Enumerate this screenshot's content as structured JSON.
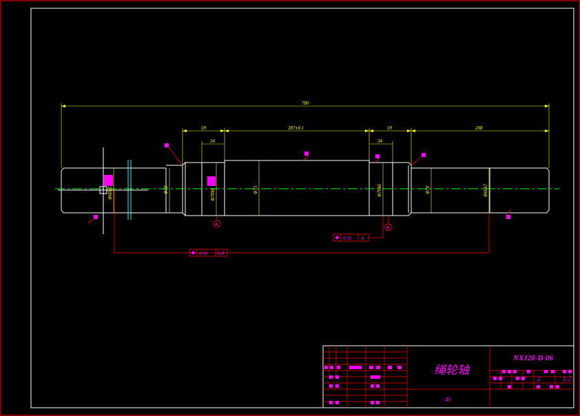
{
  "drawing": {
    "part_name": "绳轮轴",
    "drawing_number": "NXJ20-D-06",
    "material": "45",
    "sheet_count": "2",
    "scale": "1:2"
  },
  "dimensions": {
    "overall_length": "780",
    "seg_left": "59",
    "seg_center": "287±0.1",
    "seg_right": "59",
    "seg_end": "208",
    "key_left": "34",
    "key_right": "34",
    "dia_left": "Φ70",
    "dia_center": "Φ75",
    "dia_right": "Φ70k6",
    "dia_right2": "Φ70",
    "dia_end": "Φ60k7",
    "dia_leftend": "Φ60k6",
    "dia_key_left": "Φ70k6"
  },
  "tolerances": {
    "runout_ab": "0.04",
    "runout_ab_datum": "A-B",
    "runout_a": "0.02",
    "runout_a_datum": "A"
  },
  "datums": {
    "a": "A",
    "b": "B"
  },
  "colors": {
    "frame": "#ffffff",
    "outline": "#ffffff",
    "dimension": "#ffff00",
    "centerline": "#00cc00",
    "annotation": "#ff00ff",
    "leader": "#ff0000",
    "axis_marker": "#00ffff"
  }
}
